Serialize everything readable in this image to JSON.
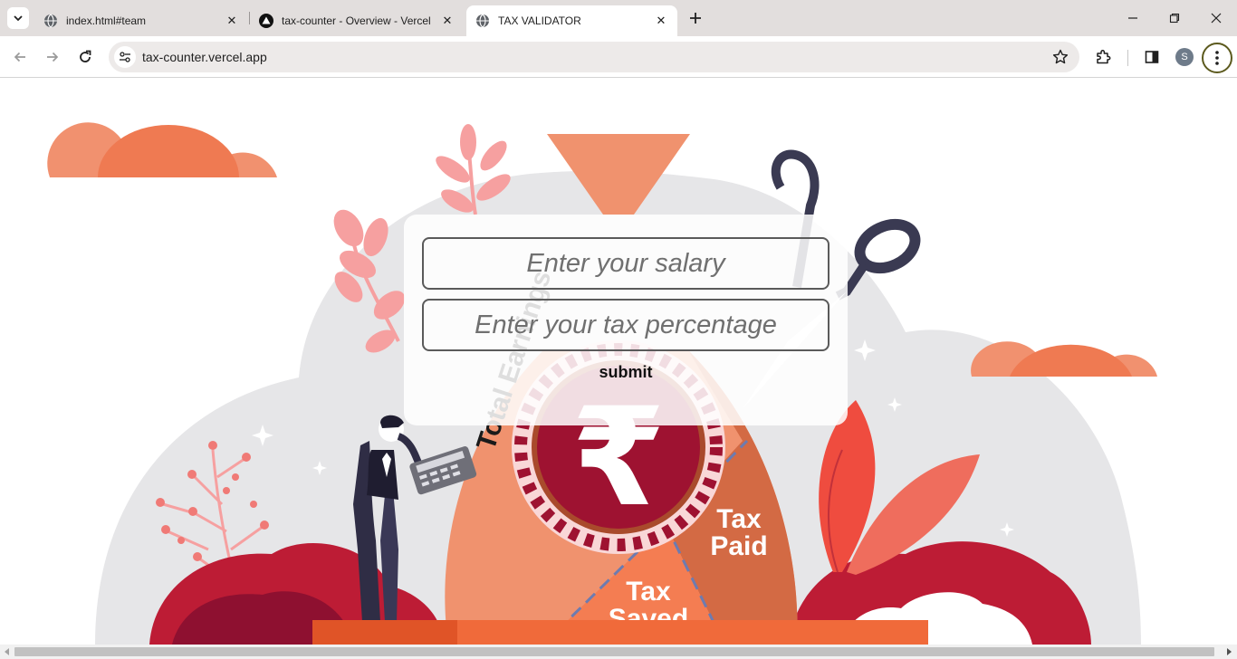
{
  "browser": {
    "tabs": [
      {
        "title": "index.html#team",
        "favicon": "globe-icon",
        "active": false
      },
      {
        "title": "tax-counter - Overview - Vercel",
        "favicon": "vercel-triangle-icon",
        "active": false
      },
      {
        "title": "TAX VALIDATOR",
        "favicon": "globe-icon",
        "active": true
      }
    ],
    "address": "tax-counter.vercel.app",
    "profile_initial": "S"
  },
  "form": {
    "salary_placeholder": "Enter your salary",
    "tax_placeholder": "Enter your tax percentage",
    "submit_label": "submit"
  },
  "illustration": {
    "sack_label": "Total Earnings",
    "currency_symbol": "₹",
    "tax_paid_line1": "Tax",
    "tax_paid_line2": "Paid",
    "tax_saved_line1": "Tax",
    "tax_saved_line2": "Saved"
  },
  "colors": {
    "coral": "#f07a50",
    "maroon": "#9e1231",
    "salmon": "#f0926e",
    "pink": "#f6a0a0",
    "cloud_gray": "#e6e6e8"
  }
}
